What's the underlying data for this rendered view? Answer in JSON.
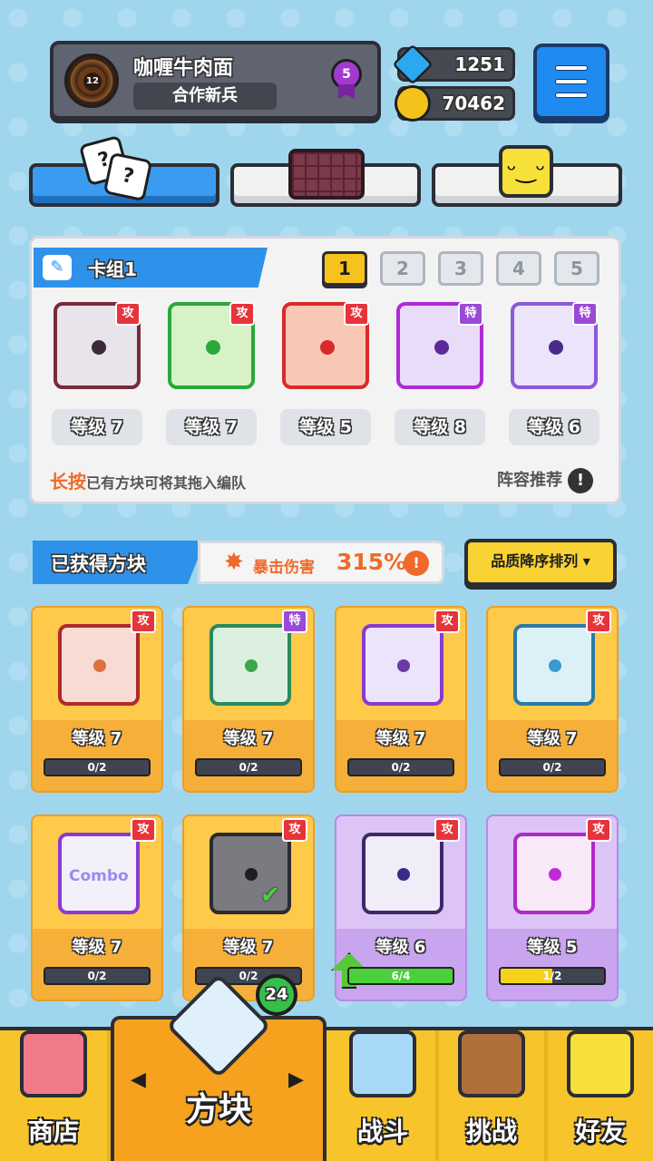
{
  "profile": {
    "name": "咖喱牛肉面",
    "rank": "合作新兵",
    "level": "12",
    "badge": "5"
  },
  "currency": {
    "gems": "1251",
    "gold": "70462"
  },
  "deck": {
    "title": "卡组1",
    "numbers": [
      "1",
      "2",
      "3",
      "4",
      "5"
    ],
    "active_index": 0,
    "cards": [
      {
        "tag": "攻",
        "level": "等级 7"
      },
      {
        "tag": "攻",
        "level": "等级 7"
      },
      {
        "tag": "攻",
        "level": "等级 5"
      },
      {
        "tag": "特",
        "level": "等级 8"
      },
      {
        "tag": "特",
        "level": "等级 6"
      }
    ],
    "hint_prefix": "长按",
    "hint_rest": "已有方块可将其拖入编队",
    "recommend": "阵容推荐",
    "recommend_icon": "!"
  },
  "owned": {
    "title": "已获得方块",
    "crit_label": "暴击伤害",
    "crit_value": "315%",
    "crit_icon": "!",
    "sort_label": "品质降序排列 ▾",
    "cards": [
      {
        "tag": "攻",
        "level": "等级 7",
        "progress": "0/2"
      },
      {
        "tag": "特",
        "level": "等级 7",
        "progress": "0/2"
      },
      {
        "tag": "攻",
        "level": "等级 7",
        "progress": "0/2"
      },
      {
        "tag": "攻",
        "level": "等级 7",
        "progress": "0/2"
      },
      {
        "tag": "攻",
        "level": "等级 7",
        "progress": "0/2",
        "label": "Combo"
      },
      {
        "tag": "攻",
        "level": "等级 7",
        "progress": "0/2"
      },
      {
        "tag": "攻",
        "level": "等级 6",
        "progress": "6/4"
      },
      {
        "tag": "攻",
        "level": "等级 5",
        "progress": "1/2"
      }
    ]
  },
  "nav": {
    "shop": "商店",
    "dice": "方块",
    "battle": "战斗",
    "challenge": "挑战",
    "friends": "好友",
    "dice_badge": "24",
    "arrow_left": "◀",
    "arrow_right": "▶"
  },
  "icons": {
    "tab_dice": "dice-icon",
    "tab_board": "chocolate-board-icon",
    "tab_emote": "smile-icon",
    "dice_glyphs": [
      "?",
      "?"
    ],
    "smile_glyph": "ᵕ‿ᵕ",
    "edit_glyph": "✎",
    "crit_glyph": "✸",
    "check_glyph": "✔"
  },
  "colors": {
    "blue": "#2f92ea",
    "orange": "#ef6a2a",
    "yellow": "#f7c52b",
    "attack_tag": "#e5343a",
    "special_tag": "#9a4ad6"
  }
}
